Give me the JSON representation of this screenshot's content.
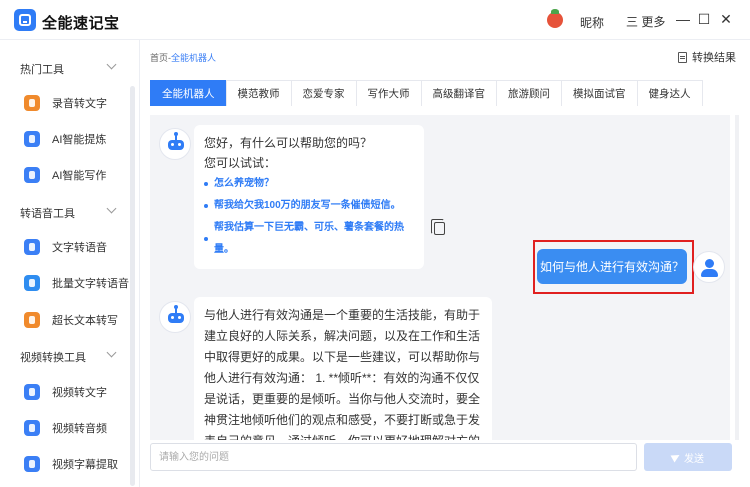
{
  "app": {
    "title": "全能速记宝"
  },
  "titlebar": {
    "nickname": "昵称",
    "more_label": "三 更多",
    "minimize": "—",
    "maximize": "☐",
    "close": "✕"
  },
  "sidebar": {
    "groups": [
      {
        "label": "热门工具",
        "items": [
          {
            "label": "录音转文字"
          },
          {
            "label": "AI智能提炼"
          },
          {
            "label": "AI智能写作"
          }
        ]
      },
      {
        "label": "转语音工具",
        "items": [
          {
            "label": "文字转语音"
          },
          {
            "label": "批量文字转语音"
          },
          {
            "label": "超长文本转写"
          }
        ]
      },
      {
        "label": "视频转换工具",
        "items": [
          {
            "label": "视频转文字"
          },
          {
            "label": "视频转音频"
          },
          {
            "label": "视频字幕提取"
          }
        ]
      }
    ]
  },
  "breadcrumb": {
    "home": "首页",
    "sep": "-",
    "current": "全能机器人"
  },
  "convert_results_label": "转换结果",
  "tabs": [
    {
      "label": "全能机器人",
      "active": true
    },
    {
      "label": "模范教师"
    },
    {
      "label": "恋爱专家"
    },
    {
      "label": "写作大师"
    },
    {
      "label": "高级翻译官"
    },
    {
      "label": "旅游顾问"
    },
    {
      "label": "模拟面试官"
    },
    {
      "label": "健身达人"
    }
  ],
  "chat": {
    "greeting_line1": "您好，有什么可以帮助您的吗？",
    "greeting_line2": "您可以试试：",
    "suggestions": [
      "怎么养宠物？",
      "帮我给欠我100万的朋友写一条催债短信。",
      "帮我估算一下巨无霸、可乐、薯条套餐的热量。"
    ],
    "user_question": "如何与他人进行有效沟通？",
    "answer": "与他人进行有效沟通是一个重要的生活技能，有助于建立良好的人际关系，解决问题，以及在工作和生活中取得更好的成果。以下是一些建议，可以帮助你与他人进行有效沟通： 1. **倾听**：有效的沟通不仅仅是说话，更重要的是倾听。当你与他人交流时，要全神贯注地倾听他们的观点和感受，不要打断或急于发表自己的意见。通过倾听，你可以更好地理解对方的需求和期望，从而做出更恰当的回应。"
  },
  "input": {
    "placeholder": "请输入您的问题",
    "send_label": "发送"
  }
}
